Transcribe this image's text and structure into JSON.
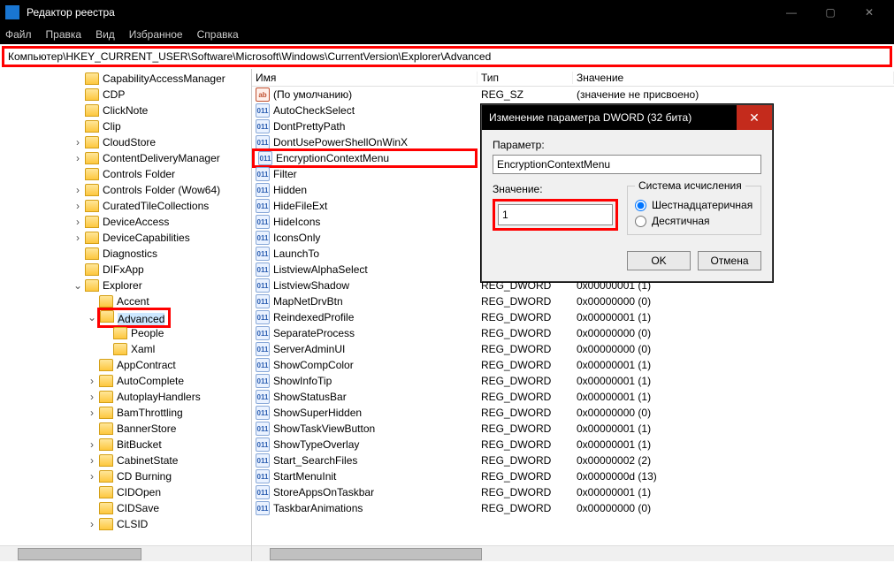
{
  "titlebar": {
    "title": "Редактор реестра"
  },
  "menubar": {
    "file": "Файл",
    "edit": "Правка",
    "view": "Вид",
    "favorites": "Избранное",
    "help": "Справка"
  },
  "addressbar": {
    "path": "Компьютер\\HKEY_CURRENT_USER\\Software\\Microsoft\\Windows\\CurrentVersion\\Explorer\\Advanced"
  },
  "tree": {
    "items": [
      {
        "indent": 5,
        "exp": "",
        "label": "CapabilityAccessManager"
      },
      {
        "indent": 5,
        "exp": "",
        "label": "CDP"
      },
      {
        "indent": 5,
        "exp": "",
        "label": "ClickNote"
      },
      {
        "indent": 5,
        "exp": "",
        "label": "Clip"
      },
      {
        "indent": 5,
        "exp": ">",
        "label": "CloudStore"
      },
      {
        "indent": 5,
        "exp": ">",
        "label": "ContentDeliveryManager"
      },
      {
        "indent": 5,
        "exp": "",
        "label": "Controls Folder"
      },
      {
        "indent": 5,
        "exp": ">",
        "label": "Controls Folder (Wow64)"
      },
      {
        "indent": 5,
        "exp": ">",
        "label": "CuratedTileCollections"
      },
      {
        "indent": 5,
        "exp": ">",
        "label": "DeviceAccess"
      },
      {
        "indent": 5,
        "exp": ">",
        "label": "DeviceCapabilities"
      },
      {
        "indent": 5,
        "exp": "",
        "label": "Diagnostics"
      },
      {
        "indent": 5,
        "exp": "",
        "label": "DIFxApp"
      },
      {
        "indent": 5,
        "exp": "v",
        "label": "Explorer"
      },
      {
        "indent": 6,
        "exp": "",
        "label": "Accent"
      },
      {
        "indent": 6,
        "exp": "v",
        "label": "Advanced",
        "selected": true,
        "redbox": true
      },
      {
        "indent": 7,
        "exp": "",
        "label": "People"
      },
      {
        "indent": 7,
        "exp": "",
        "label": "Xaml"
      },
      {
        "indent": 6,
        "exp": "",
        "label": "AppContract"
      },
      {
        "indent": 6,
        "exp": ">",
        "label": "AutoComplete"
      },
      {
        "indent": 6,
        "exp": ">",
        "label": "AutoplayHandlers"
      },
      {
        "indent": 6,
        "exp": ">",
        "label": "BamThrottling"
      },
      {
        "indent": 6,
        "exp": "",
        "label": "BannerStore"
      },
      {
        "indent": 6,
        "exp": ">",
        "label": "BitBucket"
      },
      {
        "indent": 6,
        "exp": ">",
        "label": "CabinetState"
      },
      {
        "indent": 6,
        "exp": ">",
        "label": "CD Burning"
      },
      {
        "indent": 6,
        "exp": "",
        "label": "CIDOpen"
      },
      {
        "indent": 6,
        "exp": "",
        "label": "CIDSave"
      },
      {
        "indent": 6,
        "exp": ">",
        "label": "CLSID"
      }
    ]
  },
  "columns": {
    "name": "Имя",
    "type": "Тип",
    "value": "Значение"
  },
  "rows": [
    {
      "icon": "sz",
      "name": "(По умолчанию)",
      "type": "REG_SZ",
      "value": "(значение не присвоено)"
    },
    {
      "icon": "dw",
      "name": "AutoCheckSelect",
      "type": "",
      "value": ""
    },
    {
      "icon": "dw",
      "name": "DontPrettyPath",
      "type": "",
      "value": ""
    },
    {
      "icon": "dw",
      "name": "DontUsePowerShellOnWinX",
      "type": "",
      "value": ""
    },
    {
      "icon": "dw",
      "name": "EncryptionContextMenu",
      "type": "",
      "value": "",
      "redbox": true
    },
    {
      "icon": "dw",
      "name": "Filter",
      "type": "",
      "value": ""
    },
    {
      "icon": "dw",
      "name": "Hidden",
      "type": "",
      "value": ""
    },
    {
      "icon": "dw",
      "name": "HideFileExt",
      "type": "",
      "value": ""
    },
    {
      "icon": "dw",
      "name": "HideIcons",
      "type": "",
      "value": ""
    },
    {
      "icon": "dw",
      "name": "IconsOnly",
      "type": "",
      "value": ""
    },
    {
      "icon": "dw",
      "name": "LaunchTo",
      "type": "",
      "value": ""
    },
    {
      "icon": "dw",
      "name": "ListviewAlphaSelect",
      "type": "",
      "value": ""
    },
    {
      "icon": "dw",
      "name": "ListviewShadow",
      "type": "REG_DWORD",
      "value": "0x00000001 (1)"
    },
    {
      "icon": "dw",
      "name": "MapNetDrvBtn",
      "type": "REG_DWORD",
      "value": "0x00000000 (0)"
    },
    {
      "icon": "dw",
      "name": "ReindexedProfile",
      "type": "REG_DWORD",
      "value": "0x00000001 (1)"
    },
    {
      "icon": "dw",
      "name": "SeparateProcess",
      "type": "REG_DWORD",
      "value": "0x00000000 (0)"
    },
    {
      "icon": "dw",
      "name": "ServerAdminUI",
      "type": "REG_DWORD",
      "value": "0x00000000 (0)"
    },
    {
      "icon": "dw",
      "name": "ShowCompColor",
      "type": "REG_DWORD",
      "value": "0x00000001 (1)"
    },
    {
      "icon": "dw",
      "name": "ShowInfoTip",
      "type": "REG_DWORD",
      "value": "0x00000001 (1)"
    },
    {
      "icon": "dw",
      "name": "ShowStatusBar",
      "type": "REG_DWORD",
      "value": "0x00000001 (1)"
    },
    {
      "icon": "dw",
      "name": "ShowSuperHidden",
      "type": "REG_DWORD",
      "value": "0x00000000 (0)"
    },
    {
      "icon": "dw",
      "name": "ShowTaskViewButton",
      "type": "REG_DWORD",
      "value": "0x00000001 (1)"
    },
    {
      "icon": "dw",
      "name": "ShowTypeOverlay",
      "type": "REG_DWORD",
      "value": "0x00000001 (1)"
    },
    {
      "icon": "dw",
      "name": "Start_SearchFiles",
      "type": "REG_DWORD",
      "value": "0x00000002 (2)"
    },
    {
      "icon": "dw",
      "name": "StartMenuInit",
      "type": "REG_DWORD",
      "value": "0x0000000d (13)"
    },
    {
      "icon": "dw",
      "name": "StoreAppsOnTaskbar",
      "type": "REG_DWORD",
      "value": "0x00000001 (1)"
    },
    {
      "icon": "dw",
      "name": "TaskbarAnimations",
      "type": "REG_DWORD",
      "value": "0x00000000 (0)"
    }
  ],
  "dialog": {
    "title": "Изменение параметра DWORD (32 бита)",
    "param_label": "Параметр:",
    "param_value": "EncryptionContextMenu",
    "value_label": "Значение:",
    "value_value": "1",
    "radix_title": "Система исчисления",
    "hex_label": "Шестнадцатеричная",
    "dec_label": "Десятичная",
    "ok": "OK",
    "cancel": "Отмена"
  }
}
